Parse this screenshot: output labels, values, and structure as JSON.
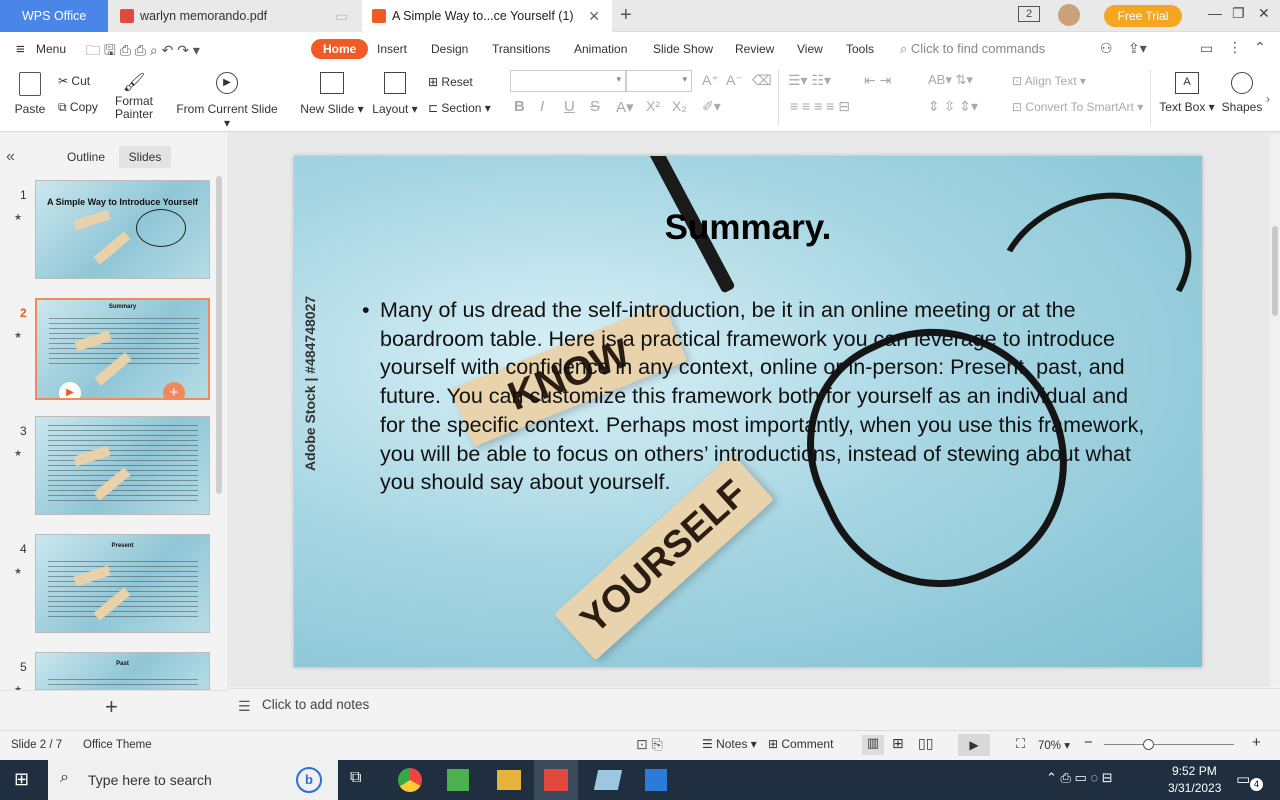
{
  "tabs": {
    "wps": "WPS Office",
    "pdf": "warlyn memorando.pdf",
    "ppt": "A Simple Way to...ce Yourself (1)"
  },
  "titlebar": {
    "free_trial": "Free Trial",
    "page_count": "2"
  },
  "menu": {
    "menu_label": "Menu",
    "tabs": [
      "Home",
      "Insert",
      "Design",
      "Transitions",
      "Animation",
      "Slide Show",
      "Review",
      "View",
      "Tools"
    ],
    "search_placeholder": "Click to find commands"
  },
  "ribbon": {
    "paste": "Paste",
    "cut": "Cut",
    "copy": "Copy",
    "format_painter_1": "Format",
    "format_painter_2": "Painter",
    "from_current_slide": "From Current Slide",
    "new_slide": "New Slide",
    "layout": "Layout",
    "reset": "Reset",
    "section": "Section",
    "align_text": "Align Text",
    "convert_smartart": "Convert To SmartArt",
    "text_box": "Text Box",
    "shapes": "Shapes"
  },
  "left_panel": {
    "outline_tab": "Outline",
    "slides_tab": "Slides",
    "slides": [
      {
        "number": "1",
        "title": "A Simple Way to Introduce Yourself"
      },
      {
        "number": "2",
        "title": "Summary"
      },
      {
        "number": "3",
        "title": ""
      },
      {
        "number": "4",
        "title": "Present"
      },
      {
        "number": "5",
        "title": "Past"
      }
    ]
  },
  "slide": {
    "title": "Summary.",
    "body": "Many of us dread the self-introduction, be it in an online meeting or at the boardroom table. Here is a practical framework you can leverage to introduce yourself with confidence in any context, online or in-person: Present, past, and future. You can customize this framework both for yourself as an individual and for the specific context. Perhaps most importantly, when you use this framework, you will be able to focus on others’ introductions, instead of stewing about what you should say about yourself.",
    "watermark": "Adobe Stock | #484748027",
    "block_know": "KNOW",
    "block_yourself": "YOURSELF"
  },
  "notes": {
    "placeholder": "Click to add notes"
  },
  "status": {
    "slide_counter": "Slide 2 / 7",
    "theme": "Office Theme",
    "notes": "Notes",
    "comment": "Comment",
    "zoom": "70%"
  },
  "taskbar": {
    "search_placeholder": "Type here to search",
    "time": "9:52 PM",
    "date": "3/31/2023",
    "notification_count": "4"
  }
}
